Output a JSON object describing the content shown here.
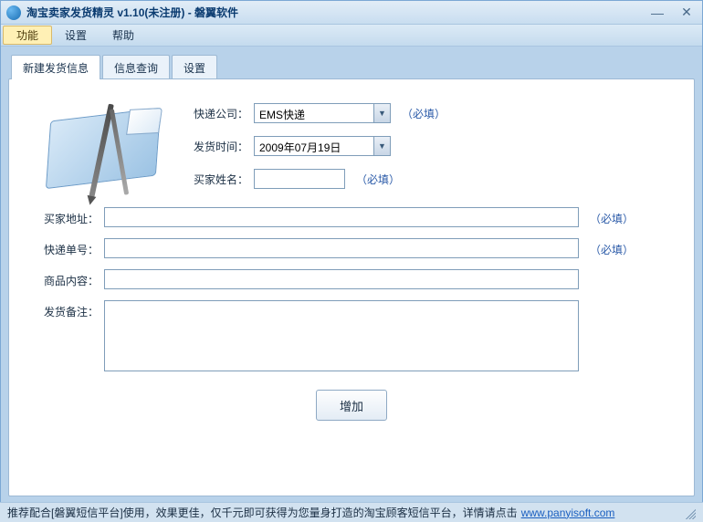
{
  "window": {
    "title": "淘宝卖家发货精灵 v1.10(未注册) - 磐翼软件"
  },
  "menu": {
    "function": "功能",
    "settings": "设置",
    "help": "帮助"
  },
  "tabs": {
    "new_shipment": "新建发货信息",
    "query": "信息查询",
    "settings": "设置"
  },
  "form": {
    "courier_label": "快递公司：",
    "courier_value": "EMS快递",
    "ship_time_label": "发货时间：",
    "ship_time_value": "2009年07月19日",
    "buyer_name_label": "买家姓名：",
    "buyer_name_value": "",
    "buyer_addr_label": "买家地址：",
    "buyer_addr_value": "",
    "tracking_label": "快递单号：",
    "tracking_value": "",
    "goods_label": "商品内容：",
    "goods_value": "",
    "remark_label": "发货备注：",
    "remark_value": "",
    "required": "（必填）",
    "add_btn": "增加"
  },
  "footer": {
    "text": "推荐配合[磐翼短信平台]使用，效果更佳，仅千元即可获得为您量身打造的淘宝顾客短信平台，详情请点击",
    "link": "www.panyisoft.com"
  }
}
